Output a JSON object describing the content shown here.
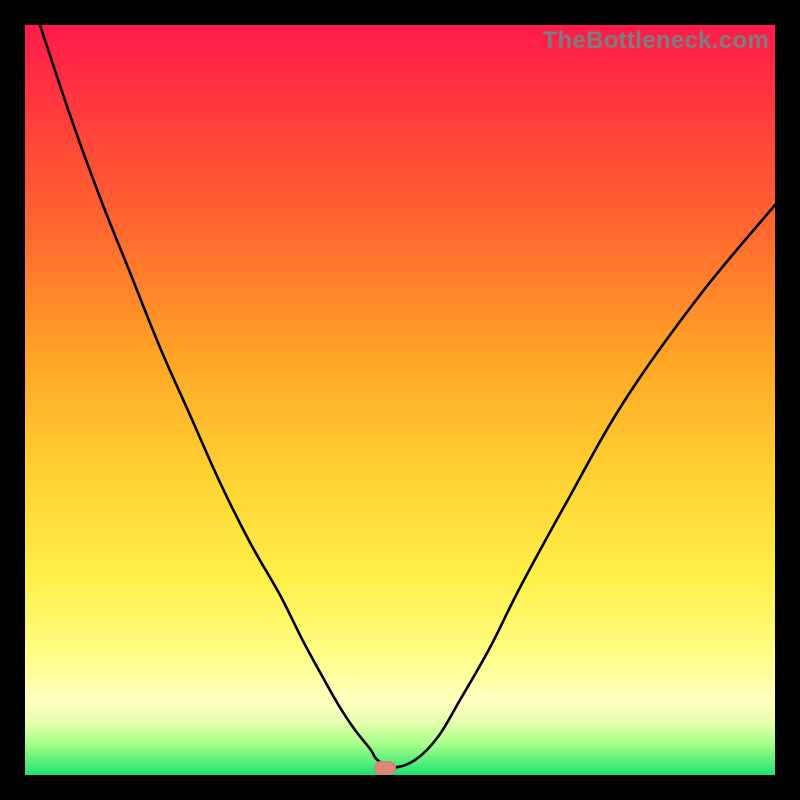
{
  "watermark": "TheBottleneck.com",
  "chart_data": {
    "type": "line",
    "title": "",
    "xlabel": "",
    "ylabel": "",
    "xlim": [
      0,
      100
    ],
    "ylim": [
      0,
      100
    ],
    "grid": false,
    "series": [
      {
        "name": "bottleneck-curve",
        "x": [
          2,
          6,
          10,
          14,
          18,
          22,
          26,
          30,
          34,
          37,
          40,
          42,
          44,
          46,
          47,
          49,
          52,
          55,
          58,
          62,
          66,
          72,
          80,
          90,
          100
        ],
        "y": [
          100,
          88,
          77,
          67,
          57,
          48,
          39,
          31,
          24,
          18,
          12.5,
          9,
          6,
          3.5,
          2,
          1,
          2,
          5,
          10,
          17,
          25,
          36,
          50,
          64,
          76
        ],
        "color": "#000000",
        "linewidth": 2.6
      }
    ],
    "marker": {
      "name": "min-point",
      "x": 48,
      "y": 1,
      "color": "#d98a7a"
    }
  }
}
